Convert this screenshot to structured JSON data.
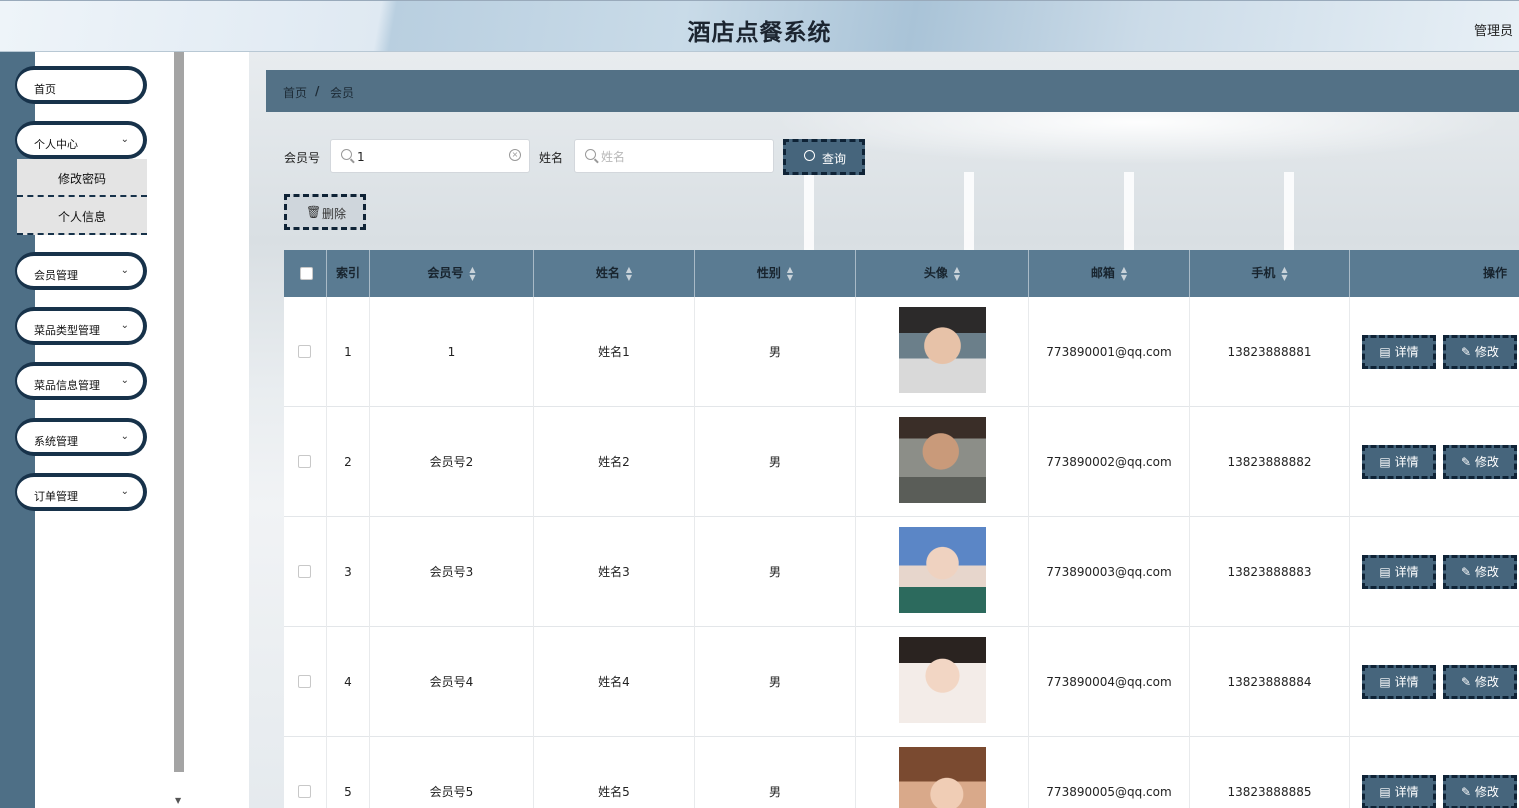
{
  "header": {
    "title": "酒店点餐系统",
    "user": "管理员"
  },
  "sidebar": {
    "items": [
      {
        "label": "首页",
        "has_arrow": false
      },
      {
        "label": "个人中心",
        "has_arrow": true
      },
      {
        "label": "会员管理",
        "has_arrow": true
      },
      {
        "label": "菜品类型管理",
        "has_arrow": true
      },
      {
        "label": "菜品信息管理",
        "has_arrow": true
      },
      {
        "label": "系统管理",
        "has_arrow": true
      },
      {
        "label": "订单管理",
        "has_arrow": true
      }
    ],
    "submenu": [
      {
        "label": "修改密码"
      },
      {
        "label": "个人信息"
      }
    ],
    "chevron": "⌄"
  },
  "breadcrumb": {
    "home": "首页",
    "separator": "/",
    "current": "会员"
  },
  "search": {
    "member_no_label": "会员号",
    "member_no_value": "1",
    "name_label": "姓名",
    "name_placeholder": "姓名",
    "query_button": "查询",
    "delete_button": "删除"
  },
  "table": {
    "columns": [
      "索引",
      "会员号",
      "姓名",
      "性别",
      "头像",
      "邮箱",
      "手机",
      "操作"
    ],
    "sort_icon": "▲▼",
    "rows": [
      {
        "index": "1",
        "member_no": "1",
        "name": "姓名1",
        "gender": "男",
        "email": "773890001@qq.com",
        "phone": "13823888881"
      },
      {
        "index": "2",
        "member_no": "会员号2",
        "name": "姓名2",
        "gender": "男",
        "email": "773890002@qq.com",
        "phone": "13823888882"
      },
      {
        "index": "3",
        "member_no": "会员号3",
        "name": "姓名3",
        "gender": "男",
        "email": "773890003@qq.com",
        "phone": "13823888883"
      },
      {
        "index": "4",
        "member_no": "会员号4",
        "name": "姓名4",
        "gender": "男",
        "email": "773890004@qq.com",
        "phone": "13823888884"
      },
      {
        "index": "5",
        "member_no": "会员号5",
        "name": "姓名5",
        "gender": "男",
        "email": "773890005@qq.com",
        "phone": "13823888885"
      }
    ],
    "detail_button": "详情",
    "edit_button": "修改"
  },
  "colors": {
    "primary": "#46657c",
    "header_bar": "#537186",
    "sidebar_stripe": "#4e6f86",
    "border_dark": "#0f2336"
  }
}
